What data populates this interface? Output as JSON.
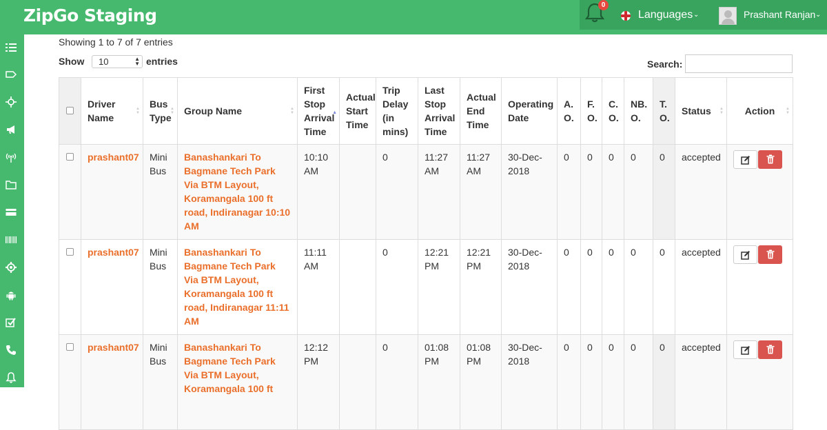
{
  "app": {
    "title": "ZipGo Staging"
  },
  "header": {
    "notification_count": "0",
    "languages_label": "Languages",
    "user_name": "Prashant Ranjan"
  },
  "sidebar": {
    "icons": [
      "list-icon",
      "tag-icon",
      "crosshair-icon",
      "megaphone-icon",
      "broadcast-icon",
      "folder-icon",
      "credit-card-icon",
      "barcode-icon",
      "gear-icon",
      "android-icon",
      "checkbox-icon",
      "phone-icon",
      "bell-icon"
    ]
  },
  "table_info": "Showing 1 to 7 of 7 entries",
  "length": {
    "show_label": "Show",
    "value": "10",
    "entries_label": "entries"
  },
  "search": {
    "label": "Search:",
    "value": ""
  },
  "columns": [
    "Driver Name",
    "Bus Type",
    "Group Name",
    "First Stop Arrival Time",
    "Actual Start Time",
    "Trip Delay (in mins)",
    "Last Stop Arrival Time",
    "Actual End Time",
    "Operating Date",
    "A. O.",
    "F. O.",
    "C. O.",
    "NB. O.",
    "T. O.",
    "Status",
    "Action"
  ],
  "rows": [
    {
      "driver": "prashant07",
      "bus_type": "Mini Bus",
      "group": "Banashankari To Bagmane Tech Park Via BTM Layout, Koramangala 100 ft road, Indiranagar 10:10 AM",
      "first_stop": "10:10 AM",
      "actual_start": "",
      "trip_delay": "0",
      "last_stop": "11:27 AM",
      "actual_end": "11:27 AM",
      "operating_date": "30-Dec-2018",
      "ao": "0",
      "fo": "0",
      "co": "0",
      "nbo": "0",
      "to": "0",
      "status": "accepted"
    },
    {
      "driver": "prashant07",
      "bus_type": "Mini Bus",
      "group": "Banashankari To Bagmane Tech Park Via BTM Layout, Koramangala 100 ft road, Indiranagar 11:11 AM",
      "first_stop": "11:11 AM",
      "actual_start": "",
      "trip_delay": "0",
      "last_stop": "12:21 PM",
      "actual_end": "12:21 PM",
      "operating_date": "30-Dec-2018",
      "ao": "0",
      "fo": "0",
      "co": "0",
      "nbo": "0",
      "to": "0",
      "status": "accepted"
    },
    {
      "driver": "prashant07",
      "bus_type": "Mini Bus",
      "group": "Banashankari To Bagmane Tech Park Via BTM Layout, Koramangala 100 ft",
      "first_stop": "12:12 PM",
      "actual_start": "",
      "trip_delay": "0",
      "last_stop": "01:08 PM",
      "actual_end": "01:08 PM",
      "operating_date": "30-Dec-2018",
      "ao": "0",
      "fo": "0",
      "co": "0",
      "nbo": "0",
      "to": "0",
      "status": "accepted"
    }
  ],
  "colors": {
    "brand": "#46b96e",
    "link": "#ea6f2b",
    "danger": "#d9534f"
  }
}
